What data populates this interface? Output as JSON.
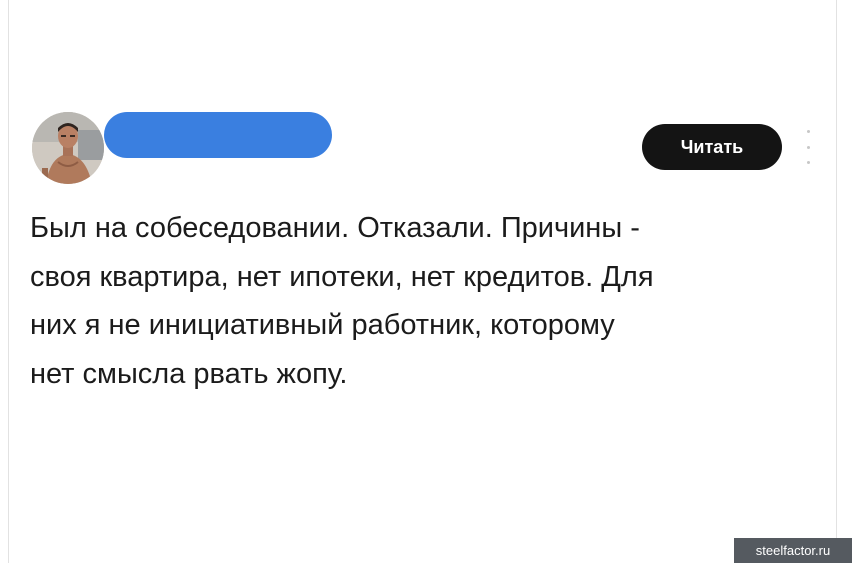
{
  "header": {
    "follow_label": "Читать",
    "avatar_icon": "user-photo-avatar",
    "more_icon": "vertical-ellipsis-icon",
    "redaction_color": "#3a7fe0"
  },
  "post": {
    "text": "Был на собеседовании. Отказали. Причины -\nсвоя квартира, нет ипотеки, нет кредитов. Для\nних я не инициативный работник, которому\nнет смысла рвать жопу."
  },
  "watermark": {
    "text": "steelfactor.ru"
  }
}
